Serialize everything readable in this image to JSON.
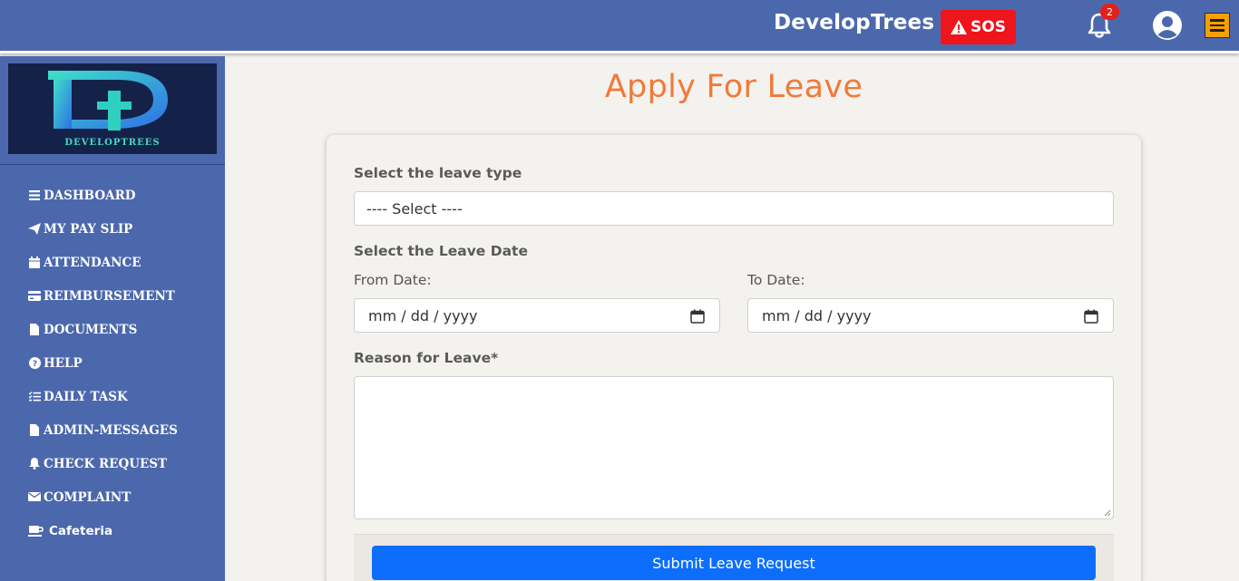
{
  "header": {
    "brand": "DevelopTrees",
    "sos_label": "SOS",
    "notification_count": "2"
  },
  "sidebar": {
    "logo_text": "DEVELOPTREES",
    "items": [
      {
        "label": "DASHBOARD",
        "icon": "list-icon"
      },
      {
        "label": "MY PAY SLIP",
        "icon": "paper-plane-icon"
      },
      {
        "label": "ATTENDANCE",
        "icon": "calendar-icon"
      },
      {
        "label": "REIMBURSEMENT",
        "icon": "credit-card-icon"
      },
      {
        "label": "DOCUMENTS",
        "icon": "file-icon"
      },
      {
        "label": "HELP",
        "icon": "question-circle-icon"
      },
      {
        "label": "DAILY TASK",
        "icon": "task-list-icon"
      },
      {
        "label": "ADMIN-MESSAGES",
        "icon": "file-icon"
      },
      {
        "label": "CHECK REQUEST",
        "icon": "bell-icon"
      },
      {
        "label": "COMPLAINT",
        "icon": "envelope-icon"
      },
      {
        "label": "Cafeteria",
        "icon": "coffee-icon"
      }
    ]
  },
  "main": {
    "title": "Apply For Leave",
    "leave_type_label": "Select the leave type",
    "leave_type_value": "---- Select ----",
    "leave_date_label": "Select the Leave Date",
    "from_label": "From Date:",
    "from_placeholder": "mm / dd / yyyy",
    "to_label": "To Date:",
    "to_placeholder": "mm / dd / yyyy",
    "reason_label": "Reason for Leave*",
    "reason_value": "",
    "submit_label": "Submit Leave Request"
  },
  "colors": {
    "header_bg": "#4c68ad",
    "title": "#f07a3a",
    "sos": "#f0141c",
    "submit": "#0d6efd",
    "menu_button": "#f5a000"
  }
}
